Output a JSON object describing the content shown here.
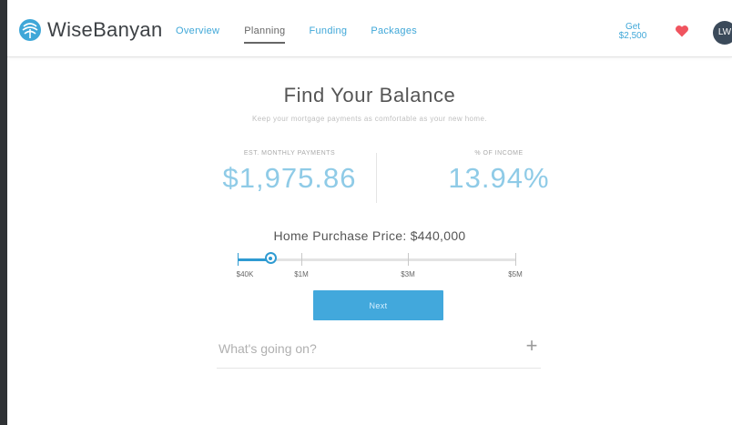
{
  "header": {
    "logo_text": "WiseBanyan",
    "nav": [
      {
        "label": "Overview",
        "active": false
      },
      {
        "label": "Planning",
        "active": true
      },
      {
        "label": "Funding",
        "active": false
      },
      {
        "label": "Packages",
        "active": false
      }
    ],
    "reward_line1": "Get",
    "reward_line2": "$2,500",
    "avatar_initials": "LW"
  },
  "main": {
    "title": "Find Your Balance",
    "subtitle": "Keep your mortgage payments as comfortable as your new home.",
    "monthly_label": "EST. MONTHLY PAYMENTS",
    "monthly_value": "$1,975.86",
    "income_label": "% OF INCOME",
    "income_value": "13.94%",
    "price_label": "Home Purchase Price: $440,000",
    "slider": {
      "min_label": "$40K",
      "ticks": [
        "$40K",
        "$1M",
        "$3M",
        "$5M"
      ],
      "value": 440000,
      "min": 40000,
      "max": 5000000
    },
    "next_label": "Next",
    "question_placeholder": "What's going on?"
  },
  "colors": {
    "accent": "#42a8dc",
    "stat_value": "#8fcbe7",
    "heart": "#f0545f"
  }
}
